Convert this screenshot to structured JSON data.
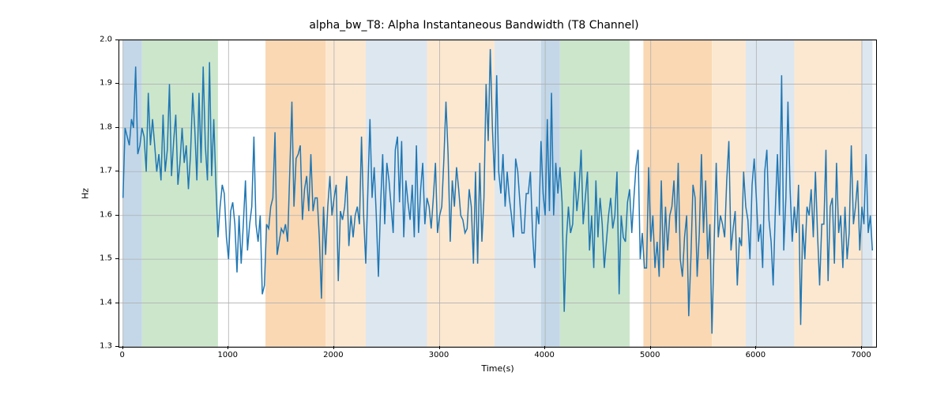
{
  "chart_data": {
    "type": "line",
    "title": "alpha_bw_T8: Alpha Instantaneous Bandwidth (T8 Channel)",
    "xlabel": "Time(s)",
    "ylabel": "Hz",
    "xlim": [
      -35,
      7135
    ],
    "ylim": [
      1.3,
      2.0
    ],
    "xticks": [
      0,
      1000,
      2000,
      3000,
      4000,
      5000,
      6000,
      7000
    ],
    "yticks": [
      1.3,
      1.4,
      1.5,
      1.6,
      1.7,
      1.8,
      1.9,
      2.0
    ],
    "xtick_labels": [
      "0",
      "1000",
      "2000",
      "3000",
      "4000",
      "5000",
      "6000",
      "7000"
    ],
    "ytick_labels": [
      "1.3",
      "1.4",
      "1.5",
      "1.6",
      "1.7",
      "1.8",
      "1.9",
      "2.0"
    ],
    "bands": [
      {
        "start": 0,
        "end": 180,
        "color": "#c3d7e8"
      },
      {
        "start": 180,
        "end": 900,
        "color": "#cce6cc"
      },
      {
        "start": 1350,
        "end": 1920,
        "color": "#fad8b3"
      },
      {
        "start": 1920,
        "end": 2300,
        "color": "#fce8d1"
      },
      {
        "start": 2300,
        "end": 2880,
        "color": "#dde7f0"
      },
      {
        "start": 2880,
        "end": 3520,
        "color": "#fce8d1"
      },
      {
        "start": 3520,
        "end": 3960,
        "color": "#dde7f0"
      },
      {
        "start": 3960,
        "end": 4140,
        "color": "#c3d7e8"
      },
      {
        "start": 4140,
        "end": 4800,
        "color": "#cce6cc"
      },
      {
        "start": 4930,
        "end": 5580,
        "color": "#fad8b3"
      },
      {
        "start": 5580,
        "end": 5900,
        "color": "#fce8d1"
      },
      {
        "start": 5900,
        "end": 6360,
        "color": "#dde7f0"
      },
      {
        "start": 6360,
        "end": 7000,
        "color": "#fce8d1"
      },
      {
        "start": 7000,
        "end": 7100,
        "color": "#dde7f0"
      }
    ],
    "series": [
      {
        "name": "alpha_bw_T8",
        "color": "#1f77b4",
        "x_step": 20,
        "x_start": 0,
        "values": [
          1.64,
          1.8,
          1.78,
          1.76,
          1.82,
          1.8,
          1.94,
          1.74,
          1.76,
          1.8,
          1.78,
          1.7,
          1.88,
          1.76,
          1.82,
          1.76,
          1.7,
          1.74,
          1.68,
          1.83,
          1.7,
          1.75,
          1.9,
          1.69,
          1.77,
          1.83,
          1.67,
          1.72,
          1.8,
          1.72,
          1.76,
          1.66,
          1.74,
          1.88,
          1.8,
          1.68,
          1.88,
          1.72,
          1.94,
          1.76,
          1.68,
          1.95,
          1.69,
          1.82,
          1.67,
          1.55,
          1.62,
          1.67,
          1.65,
          1.55,
          1.5,
          1.61,
          1.63,
          1.58,
          1.47,
          1.6,
          1.49,
          1.58,
          1.68,
          1.52,
          1.58,
          1.62,
          1.78,
          1.58,
          1.54,
          1.6,
          1.42,
          1.44,
          1.58,
          1.57,
          1.62,
          1.64,
          1.79,
          1.51,
          1.54,
          1.57,
          1.56,
          1.58,
          1.54,
          1.7,
          1.86,
          1.62,
          1.73,
          1.74,
          1.76,
          1.59,
          1.66,
          1.69,
          1.61,
          1.74,
          1.61,
          1.64,
          1.64,
          1.55,
          1.41,
          1.62,
          1.51,
          1.62,
          1.69,
          1.6,
          1.64,
          1.67,
          1.45,
          1.61,
          1.59,
          1.62,
          1.69,
          1.53,
          1.6,
          1.55,
          1.6,
          1.62,
          1.58,
          1.78,
          1.6,
          1.49,
          1.66,
          1.82,
          1.64,
          1.71,
          1.6,
          1.46,
          1.62,
          1.74,
          1.58,
          1.72,
          1.68,
          1.62,
          1.56,
          1.75,
          1.78,
          1.63,
          1.77,
          1.55,
          1.68,
          1.63,
          1.59,
          1.67,
          1.55,
          1.76,
          1.56,
          1.66,
          1.72,
          1.58,
          1.64,
          1.62,
          1.57,
          1.64,
          1.72,
          1.56,
          1.6,
          1.62,
          1.73,
          1.86,
          1.74,
          1.54,
          1.68,
          1.62,
          1.71,
          1.66,
          1.6,
          1.59,
          1.56,
          1.57,
          1.66,
          1.62,
          1.49,
          1.7,
          1.49,
          1.72,
          1.54,
          1.64,
          1.9,
          1.77,
          1.98,
          1.8,
          1.68,
          1.92,
          1.7,
          1.65,
          1.74,
          1.62,
          1.7,
          1.64,
          1.6,
          1.55,
          1.73,
          1.7,
          1.63,
          1.56,
          1.56,
          1.65,
          1.65,
          1.7,
          1.56,
          1.48,
          1.62,
          1.58,
          1.77,
          1.65,
          1.6,
          1.82,
          1.61,
          1.88,
          1.6,
          1.72,
          1.65,
          1.71,
          1.63,
          1.38,
          1.54,
          1.62,
          1.56,
          1.58,
          1.7,
          1.61,
          1.66,
          1.75,
          1.58,
          1.64,
          1.7,
          1.52,
          1.6,
          1.48,
          1.68,
          1.55,
          1.64,
          1.58,
          1.48,
          1.54,
          1.6,
          1.64,
          1.57,
          1.6,
          1.7,
          1.42,
          1.6,
          1.55,
          1.54,
          1.63,
          1.66,
          1.56,
          1.64,
          1.71,
          1.75,
          1.5,
          1.56,
          1.48,
          1.48,
          1.71,
          1.54,
          1.6,
          1.48,
          1.54,
          1.46,
          1.68,
          1.48,
          1.62,
          1.52,
          1.6,
          1.62,
          1.68,
          1.56,
          1.72,
          1.5,
          1.46,
          1.55,
          1.6,
          1.37,
          1.5,
          1.67,
          1.64,
          1.46,
          1.56,
          1.74,
          1.56,
          1.68,
          1.5,
          1.58,
          1.33,
          1.53,
          1.72,
          1.55,
          1.6,
          1.58,
          1.55,
          1.68,
          1.77,
          1.52,
          1.57,
          1.61,
          1.44,
          1.55,
          1.53,
          1.7,
          1.62,
          1.59,
          1.5,
          1.67,
          1.73,
          1.64,
          1.54,
          1.58,
          1.48,
          1.7,
          1.75,
          1.59,
          1.54,
          1.44,
          1.61,
          1.74,
          1.6,
          1.92,
          1.52,
          1.64,
          1.86,
          1.66,
          1.54,
          1.62,
          1.56,
          1.67,
          1.35,
          1.58,
          1.5,
          1.62,
          1.6,
          1.66,
          1.55,
          1.7,
          1.56,
          1.44,
          1.58,
          1.58,
          1.75,
          1.45,
          1.62,
          1.64,
          1.49,
          1.72,
          1.56,
          1.6,
          1.48,
          1.62,
          1.5,
          1.56,
          1.76,
          1.58,
          1.62,
          1.68,
          1.52,
          1.62,
          1.58,
          1.74,
          1.56,
          1.6,
          1.52
        ]
      }
    ]
  }
}
